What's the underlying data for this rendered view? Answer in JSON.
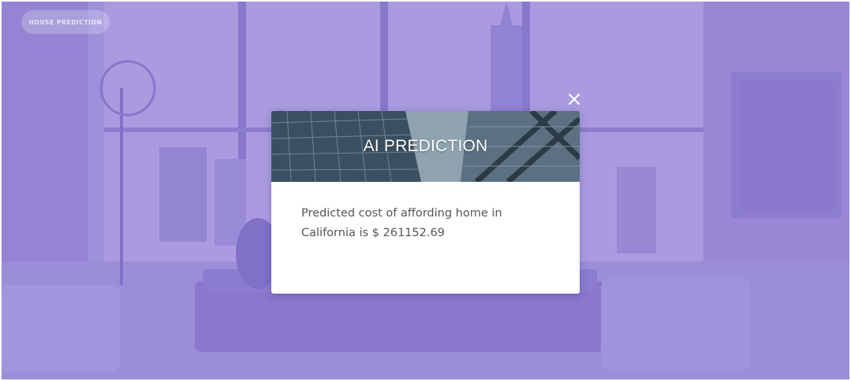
{
  "brand": {
    "label": "HOUSE PREDICTION"
  },
  "modal": {
    "title": "AI PREDICTION",
    "message_prefix": "Predicted cost of affording home in",
    "message_line2_prefix": "California is $ ",
    "predicted_value": "261152.69"
  },
  "icons": {
    "close": "close-icon"
  },
  "colors": {
    "overlay": "#7b68d3",
    "modal_bg": "#ffffff",
    "text": "#555555"
  }
}
